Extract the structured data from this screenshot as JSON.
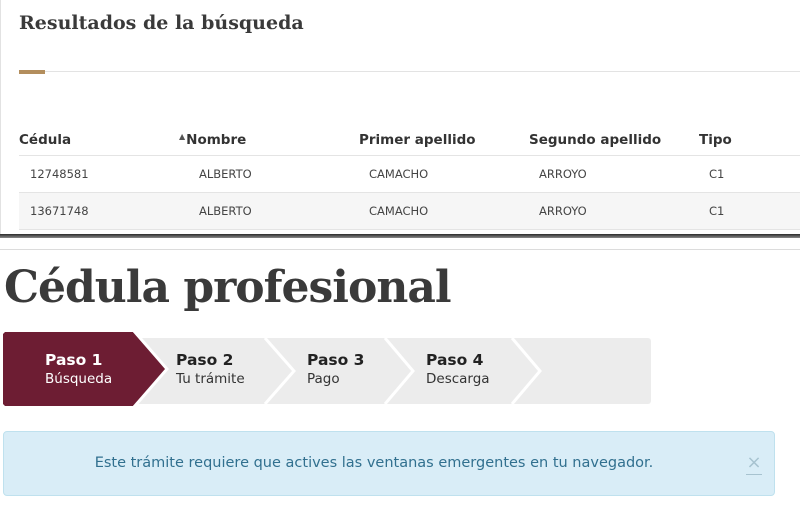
{
  "results": {
    "title": "Resultados de la búsqueda",
    "columns": [
      "Cédula",
      "Nombre",
      "Primer apellido",
      "Segundo apellido",
      "Tipo"
    ],
    "rows": [
      [
        "12748581",
        "ALBERTO",
        "CAMACHO",
        "ARROYO",
        "C1"
      ],
      [
        "13671748",
        "ALBERTO",
        "CAMACHO",
        "ARROYO",
        "C1"
      ]
    ],
    "sorted_column": "Nombre"
  },
  "page": {
    "title": "Cédula profesional"
  },
  "stepper": {
    "steps": [
      {
        "title": "Paso 1",
        "subtitle": "Búsqueda",
        "active": true
      },
      {
        "title": "Paso 2",
        "subtitle": "Tu trámite",
        "active": false
      },
      {
        "title": "Paso 3",
        "subtitle": "Pago",
        "active": false
      },
      {
        "title": "Paso 4",
        "subtitle": "Descarga",
        "active": false
      }
    ],
    "colors": {
      "active": "#6d1d33",
      "inactive": "#ececec",
      "separator": "#ffffff"
    }
  },
  "alert": {
    "text": "Este trámite requiere que actives las ventanas emergentes en tu navegador.",
    "close_icon": "close-icon",
    "close_glyph": "×",
    "colors": {
      "background": "#d9edf7",
      "text": "#31708f"
    }
  },
  "icons": {
    "sort": "sort-asc-icon",
    "sort_glyph": "▲"
  }
}
